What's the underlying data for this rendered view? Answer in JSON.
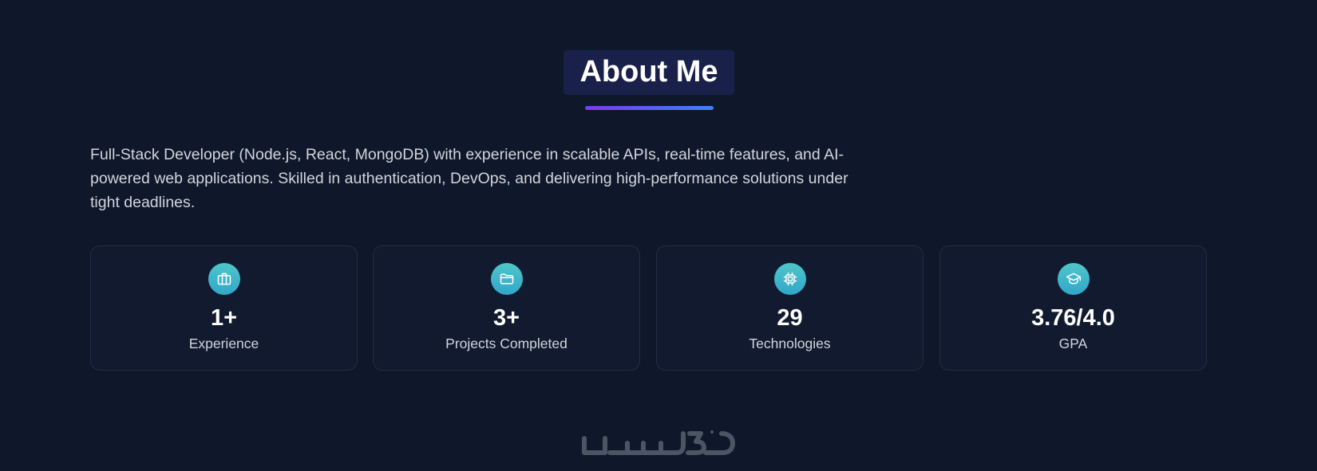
{
  "section": {
    "title": "About Me",
    "bio": "Full-Stack Developer (Node.js, React, MongoDB) with experience in scalable APIs, real-time features, and AI-powered web applications. Skilled in authentication, DevOps, and delivering high-performance solutions under tight deadlines."
  },
  "stats": [
    {
      "icon": "briefcase-icon",
      "value": "1+",
      "label": "Experience"
    },
    {
      "icon": "folder-icon",
      "value": "3+",
      "label": "Projects Completed"
    },
    {
      "icon": "cpu-chip-icon",
      "value": "29",
      "label": "Technologies"
    },
    {
      "icon": "graduation-cap-icon",
      "value": "3.76/4.0",
      "label": "GPA"
    }
  ],
  "watermark": {
    "text": "خمسات"
  },
  "colors": {
    "background": "#0f172a",
    "card_background": "#111a2f",
    "card_border": "#232d44",
    "title_background": "#19214a",
    "accent_gradient_start": "#7c3aed",
    "accent_gradient_end": "#3b82f6",
    "icon_gradient_top": "#4fc6c9",
    "icon_gradient_bottom": "#31a7c9",
    "text_primary": "#ffffff",
    "text_secondary": "#d1d5db"
  }
}
